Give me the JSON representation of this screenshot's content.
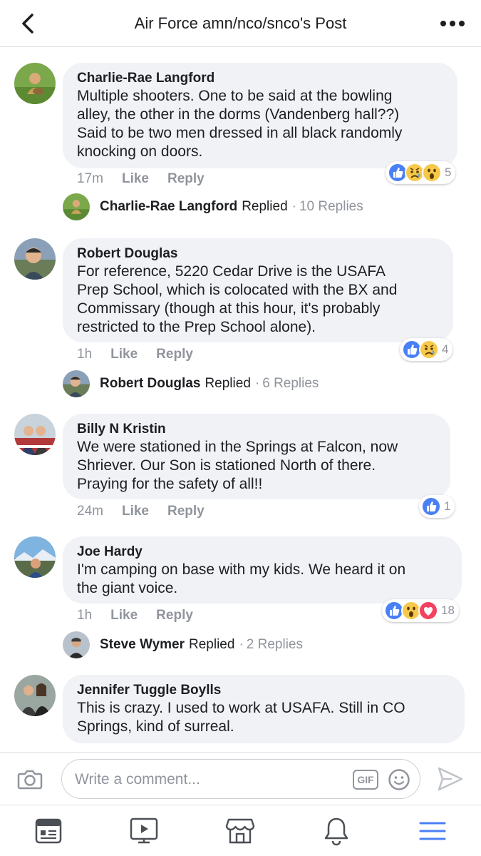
{
  "header": {
    "title": "Air Force amn/nco/snco's Post",
    "back_icon": "chevron-left-icon",
    "more_icon": "more-dots-icon"
  },
  "colors": {
    "like_blue": "#4a80f5",
    "love_red": "#f3425f",
    "wow_yellow": "#f7c94b",
    "meta_gray": "#90949c",
    "bubble_bg": "#f0f2f5",
    "active_tab": "#4a80f5"
  },
  "comments": [
    {
      "author": "Charlie-Rae Langford",
      "text_lines": [
        "Multiple shooters. One to be said at the bowling",
        "alley, the other in the dorms (Vandenberg hall??)",
        "Said to be two men dressed in all black randomly",
        "knocking on doors."
      ],
      "time": "17m",
      "like_label": "Like",
      "reply_label": "Reply",
      "reactions": [
        "like",
        "sad",
        "wow"
      ],
      "reaction_count": "5",
      "replied": {
        "name": "Charlie-Rae Langford",
        "replied_label": "Replied",
        "separator": "·",
        "count": "10 Replies"
      }
    },
    {
      "author": "Robert Douglas",
      "text_lines": [
        "For reference, 5220 Cedar Drive is the USAFA",
        "Prep School, which is colocated with the BX and",
        "Commissary (though at this hour, it's probably",
        "restricted to the Prep School alone)."
      ],
      "time": "1h",
      "like_label": "Like",
      "reply_label": "Reply",
      "reactions": [
        "like",
        "sad"
      ],
      "reaction_count": "4",
      "replied": {
        "name": "Robert Douglas",
        "replied_label": "Replied",
        "separator": "·",
        "count": "6 Replies"
      }
    },
    {
      "author": "Billy N Kristin",
      "text_lines": [
        "We were stationed in the Springs at Falcon, now",
        "Shriever. Our Son is stationed North of there.",
        "Praying for the safety of all!!"
      ],
      "time": "24m",
      "like_label": "Like",
      "reply_label": "Reply",
      "reactions": [
        "like"
      ],
      "reaction_count": "1"
    },
    {
      "author": "Joe Hardy",
      "text_lines": [
        "I'm camping on base with my kids. We heard it on",
        "the giant voice."
      ],
      "time": "1h",
      "like_label": "Like",
      "reply_label": "Reply",
      "reactions": [
        "like",
        "wow",
        "love"
      ],
      "reaction_count": "18",
      "replied": {
        "name": "Steve Wymer",
        "replied_label": "Replied",
        "separator": "·",
        "count": "2 Replies"
      }
    },
    {
      "author": "Jennifer Tuggle Boylls",
      "text_lines": [
        "This is crazy.  I used to work at USAFA.  Still in CO",
        "Springs, kind of surreal."
      ]
    }
  ],
  "composer": {
    "placeholder": "Write a comment...",
    "gif_label": "GIF",
    "camera_icon": "camera-icon",
    "emoji_icon": "emoji-icon",
    "send_icon": "send-icon"
  },
  "tabbar": {
    "items": [
      "news-feed-icon",
      "watch-icon",
      "marketplace-icon",
      "notifications-icon",
      "menu-icon"
    ],
    "active": "menu-icon"
  }
}
